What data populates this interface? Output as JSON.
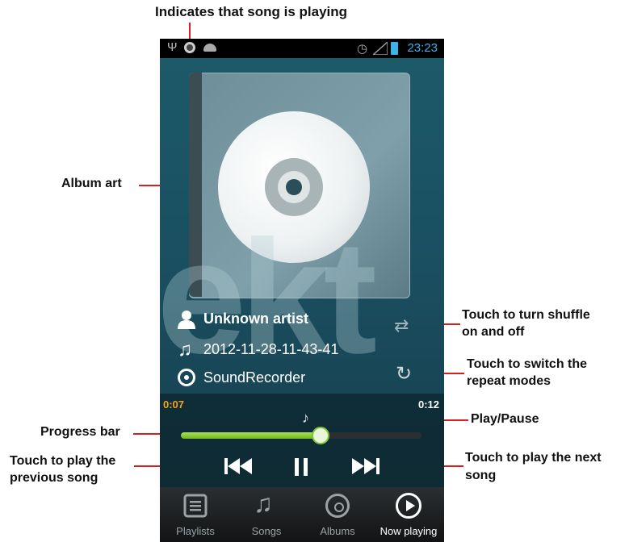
{
  "annotations": {
    "playing_indicator": "Indicates that song is playing",
    "album_art": "Album art",
    "shuffle_line1": "Touch to turn shuffle",
    "shuffle_line2": "on and off",
    "repeat_line1": "Touch to switch the",
    "repeat_line2": "repeat modes",
    "progress_bar": "Progress bar",
    "play_pause": "Play/Pause",
    "prev_line1": "Touch to play the",
    "prev_line2": "previous song",
    "next_line1": "Touch to play the next",
    "next_line2": "song"
  },
  "status_bar": {
    "time": "23:23"
  },
  "album_art": {
    "watermark": "ekt"
  },
  "track": {
    "artist": "Unknown artist",
    "title": "2012-11-28-11-43-41",
    "album": "SoundRecorder"
  },
  "progress": {
    "elapsed": "0:07",
    "total": "0:12",
    "fraction": 0.58
  },
  "tabs": [
    {
      "label": "Playlists"
    },
    {
      "label": "Songs"
    },
    {
      "label": "Albums"
    },
    {
      "label": "Now playing"
    }
  ],
  "colors": {
    "accent_green": "#8ccf3d",
    "clock_blue": "#3fb3e6",
    "elapsed_orange": "#f4a21b",
    "annotation_red": "#d61f1f"
  }
}
